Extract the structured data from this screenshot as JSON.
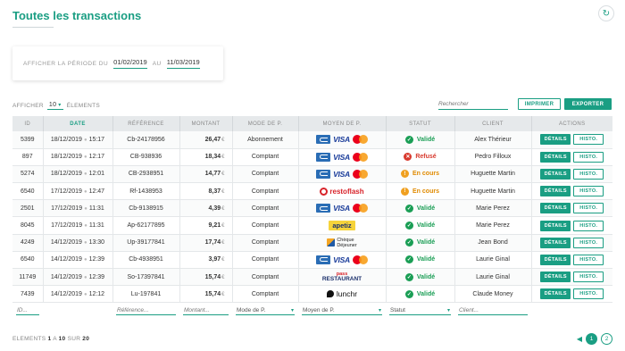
{
  "page": {
    "title": "Toutes les transactions"
  },
  "period": {
    "label_from": "AFFICHER LA PÉRIODE DU",
    "from": "01/02/2019",
    "label_to": "AU",
    "to": "11/03/2019"
  },
  "toolbar": {
    "show_label": "AFFICHER",
    "show_value": "10",
    "elements_label": "ÉLEMENTS",
    "search_placeholder": "Rechercher",
    "print_label": "IMPRIMER",
    "export_label": "EXPORTER"
  },
  "table": {
    "columns": [
      "ID",
      "DATE",
      "RÉFÉRENCE",
      "MONTANT",
      "MODE DE P.",
      "MOYEN DE P.",
      "STATUT",
      "CLIENT",
      "ACTIONS"
    ],
    "currency": "€",
    "details_label": "DÉTAILS",
    "history_label": "HISTO.",
    "rows": [
      {
        "id": "5399",
        "date": "18/12/2019",
        "time": "15:17",
        "ref": "Cb-24178956",
        "amount": "26,47",
        "mode": "Abonnement",
        "payment": "cb-visa-mc",
        "status": "Validé",
        "status_kind": "valide",
        "client": "Alex Thérieur"
      },
      {
        "id": "897",
        "date": "18/12/2019",
        "time": "12:17",
        "ref": "CB-938936",
        "amount": "18,34",
        "mode": "Comptant",
        "payment": "cb-visa-mc",
        "status": "Refusé",
        "status_kind": "refuse",
        "client": "Pedro Filloux"
      },
      {
        "id": "5274",
        "date": "18/12/2019",
        "time": "12:01",
        "ref": "CB-2938951",
        "amount": "14,77",
        "mode": "Comptant",
        "payment": "cb-visa-mc",
        "status": "En cours",
        "status_kind": "encours",
        "client": "Huguette Martin"
      },
      {
        "id": "6540",
        "date": "17/12/2019",
        "time": "12:47",
        "ref": "Rf-1438953",
        "amount": "8,37",
        "mode": "Comptant",
        "payment": "restoflash",
        "status": "En cours",
        "status_kind": "encours",
        "client": "Huguette Martin"
      },
      {
        "id": "2501",
        "date": "17/12/2019",
        "time": "11:31",
        "ref": "Cb-9138915",
        "amount": "4,39",
        "mode": "Comptant",
        "payment": "cb-visa-mc",
        "status": "Validé",
        "status_kind": "valide",
        "client": "Marie Perez"
      },
      {
        "id": "8045",
        "date": "17/12/2019",
        "time": "11:31",
        "ref": "Ap-62177895",
        "amount": "9,21",
        "mode": "Comptant",
        "payment": "apetiz",
        "status": "Validé",
        "status_kind": "valide",
        "client": "Marie Perez"
      },
      {
        "id": "4249",
        "date": "14/12/2019",
        "time": "13:30",
        "ref": "Up-39177841",
        "amount": "17,74",
        "mode": "Comptant",
        "payment": "cheque-dejeuner",
        "status": "Validé",
        "status_kind": "valide",
        "client": "Jean Bond"
      },
      {
        "id": "6540",
        "date": "14/12/2019",
        "time": "12:39",
        "ref": "Cb-4938951",
        "amount": "3,97",
        "mode": "Comptant",
        "payment": "cb-visa-mc",
        "status": "Validé",
        "status_kind": "valide",
        "client": "Laurie Ginal"
      },
      {
        "id": "11749",
        "date": "14/12/2019",
        "time": "12:39",
        "ref": "So-17397841",
        "amount": "15,74",
        "mode": "Comptant",
        "payment": "restaurant-pass",
        "status": "Validé",
        "status_kind": "valide",
        "client": "Laurie Ginal"
      },
      {
        "id": "7439",
        "date": "14/12/2019",
        "time": "12:12",
        "ref": "Lu-197841",
        "amount": "15,74",
        "mode": "Comptant",
        "payment": "lunchr",
        "status": "Validé",
        "status_kind": "valide",
        "client": "Claude Money"
      }
    ]
  },
  "payment_logos": {
    "visa": "VISA",
    "restoflash": "restoflash",
    "apetiz": "apetiz",
    "cheque_line1": "Chèque",
    "cheque_line2": "Déjeuner",
    "pass": "pass",
    "restaurant": "RESTAURANT",
    "lunchr": "lunchr"
  },
  "filters": {
    "id": "ID...",
    "ref": "Référence...",
    "amount": "Montant...",
    "mode": "Mode de P.",
    "moyen": "Moyen de P.",
    "statut": "Statut",
    "client": "Client..."
  },
  "footer": {
    "prefix": "ELEMENTS",
    "from": "1",
    "a": "A",
    "to": "10",
    "sur": "SUR",
    "total": "20"
  },
  "pagination": {
    "pages": [
      "1",
      "2"
    ],
    "current": "1"
  },
  "colors": {
    "accent": "#1a9e83",
    "valide": "#1a9e55",
    "refuse": "#d83a2e",
    "encours": "#e08a00"
  }
}
